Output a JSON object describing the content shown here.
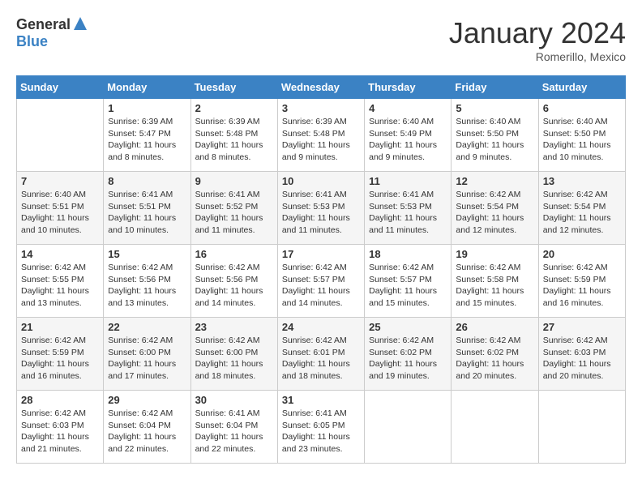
{
  "header": {
    "logo_general": "General",
    "logo_blue": "Blue",
    "month_title": "January 2024",
    "location": "Romerillo, Mexico"
  },
  "calendar": {
    "days_of_week": [
      "Sunday",
      "Monday",
      "Tuesday",
      "Wednesday",
      "Thursday",
      "Friday",
      "Saturday"
    ],
    "weeks": [
      [
        {
          "day": "",
          "info": ""
        },
        {
          "day": "1",
          "info": "Sunrise: 6:39 AM\nSunset: 5:47 PM\nDaylight: 11 hours\nand 8 minutes."
        },
        {
          "day": "2",
          "info": "Sunrise: 6:39 AM\nSunset: 5:48 PM\nDaylight: 11 hours\nand 8 minutes."
        },
        {
          "day": "3",
          "info": "Sunrise: 6:39 AM\nSunset: 5:48 PM\nDaylight: 11 hours\nand 9 minutes."
        },
        {
          "day": "4",
          "info": "Sunrise: 6:40 AM\nSunset: 5:49 PM\nDaylight: 11 hours\nand 9 minutes."
        },
        {
          "day": "5",
          "info": "Sunrise: 6:40 AM\nSunset: 5:50 PM\nDaylight: 11 hours\nand 9 minutes."
        },
        {
          "day": "6",
          "info": "Sunrise: 6:40 AM\nSunset: 5:50 PM\nDaylight: 11 hours\nand 10 minutes."
        }
      ],
      [
        {
          "day": "7",
          "info": "Sunrise: 6:40 AM\nSunset: 5:51 PM\nDaylight: 11 hours\nand 10 minutes."
        },
        {
          "day": "8",
          "info": "Sunrise: 6:41 AM\nSunset: 5:51 PM\nDaylight: 11 hours\nand 10 minutes."
        },
        {
          "day": "9",
          "info": "Sunrise: 6:41 AM\nSunset: 5:52 PM\nDaylight: 11 hours\nand 11 minutes."
        },
        {
          "day": "10",
          "info": "Sunrise: 6:41 AM\nSunset: 5:53 PM\nDaylight: 11 hours\nand 11 minutes."
        },
        {
          "day": "11",
          "info": "Sunrise: 6:41 AM\nSunset: 5:53 PM\nDaylight: 11 hours\nand 11 minutes."
        },
        {
          "day": "12",
          "info": "Sunrise: 6:42 AM\nSunset: 5:54 PM\nDaylight: 11 hours\nand 12 minutes."
        },
        {
          "day": "13",
          "info": "Sunrise: 6:42 AM\nSunset: 5:54 PM\nDaylight: 11 hours\nand 12 minutes."
        }
      ],
      [
        {
          "day": "14",
          "info": "Sunrise: 6:42 AM\nSunset: 5:55 PM\nDaylight: 11 hours\nand 13 minutes."
        },
        {
          "day": "15",
          "info": "Sunrise: 6:42 AM\nSunset: 5:56 PM\nDaylight: 11 hours\nand 13 minutes."
        },
        {
          "day": "16",
          "info": "Sunrise: 6:42 AM\nSunset: 5:56 PM\nDaylight: 11 hours\nand 14 minutes."
        },
        {
          "day": "17",
          "info": "Sunrise: 6:42 AM\nSunset: 5:57 PM\nDaylight: 11 hours\nand 14 minutes."
        },
        {
          "day": "18",
          "info": "Sunrise: 6:42 AM\nSunset: 5:57 PM\nDaylight: 11 hours\nand 15 minutes."
        },
        {
          "day": "19",
          "info": "Sunrise: 6:42 AM\nSunset: 5:58 PM\nDaylight: 11 hours\nand 15 minutes."
        },
        {
          "day": "20",
          "info": "Sunrise: 6:42 AM\nSunset: 5:59 PM\nDaylight: 11 hours\nand 16 minutes."
        }
      ],
      [
        {
          "day": "21",
          "info": "Sunrise: 6:42 AM\nSunset: 5:59 PM\nDaylight: 11 hours\nand 16 minutes."
        },
        {
          "day": "22",
          "info": "Sunrise: 6:42 AM\nSunset: 6:00 PM\nDaylight: 11 hours\nand 17 minutes."
        },
        {
          "day": "23",
          "info": "Sunrise: 6:42 AM\nSunset: 6:00 PM\nDaylight: 11 hours\nand 18 minutes."
        },
        {
          "day": "24",
          "info": "Sunrise: 6:42 AM\nSunset: 6:01 PM\nDaylight: 11 hours\nand 18 minutes."
        },
        {
          "day": "25",
          "info": "Sunrise: 6:42 AM\nSunset: 6:02 PM\nDaylight: 11 hours\nand 19 minutes."
        },
        {
          "day": "26",
          "info": "Sunrise: 6:42 AM\nSunset: 6:02 PM\nDaylight: 11 hours\nand 20 minutes."
        },
        {
          "day": "27",
          "info": "Sunrise: 6:42 AM\nSunset: 6:03 PM\nDaylight: 11 hours\nand 20 minutes."
        }
      ],
      [
        {
          "day": "28",
          "info": "Sunrise: 6:42 AM\nSunset: 6:03 PM\nDaylight: 11 hours\nand 21 minutes."
        },
        {
          "day": "29",
          "info": "Sunrise: 6:42 AM\nSunset: 6:04 PM\nDaylight: 11 hours\nand 22 minutes."
        },
        {
          "day": "30",
          "info": "Sunrise: 6:41 AM\nSunset: 6:04 PM\nDaylight: 11 hours\nand 22 minutes."
        },
        {
          "day": "31",
          "info": "Sunrise: 6:41 AM\nSunset: 6:05 PM\nDaylight: 11 hours\nand 23 minutes."
        },
        {
          "day": "",
          "info": ""
        },
        {
          "day": "",
          "info": ""
        },
        {
          "day": "",
          "info": ""
        }
      ]
    ]
  }
}
